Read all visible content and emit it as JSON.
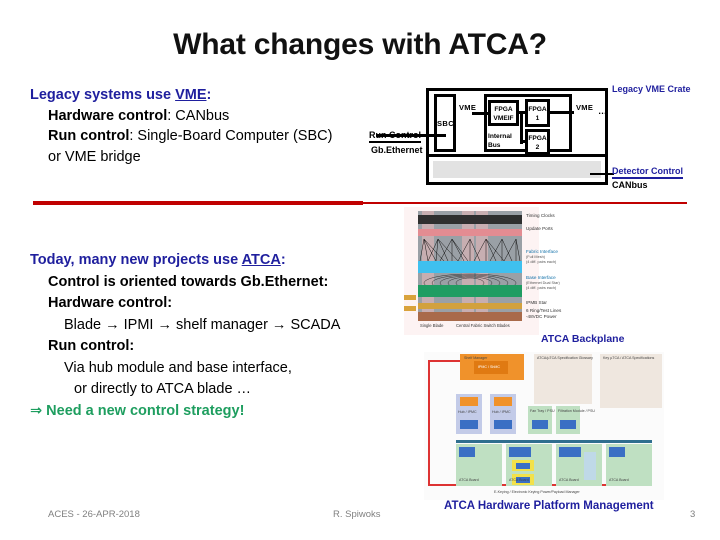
{
  "slide": {
    "title": "What changes with ATCA?",
    "page_number": "3"
  },
  "footer": {
    "left": "ACES - 26-APR-2018",
    "center": "R. Spiwoks",
    "page": "3"
  },
  "legacy_block": {
    "heading_pre": "Legacy systems use ",
    "heading_link": "VME",
    "heading_post": ":",
    "line2_bold": "Hardware control",
    "line2_rest": ": CANbus",
    "line3_bold": "Run control",
    "line3_rest": ": Single-Board Computer (SBC)",
    "line4": "or VME bridge"
  },
  "today_block": {
    "heading_pre": "Today, many new projects use ",
    "heading_link": "ATCA",
    "heading_post": ":",
    "line2": "Control is oriented towards Gb.Ethernet:",
    "line3": "Hardware control:",
    "line4": "Blade → IPMI → shelf manager → SCADA",
    "line5": "Run control:",
    "line6": "Via hub module and base interface,",
    "line7": "or directly to ATCA blade …",
    "line8": "⇒ Need a new control strategy!"
  },
  "vme_crate": {
    "title": "Legacy VME Crate",
    "sbc": "SBC",
    "vme_left": "VME",
    "vme_right": "VME",
    "ellipsis": "…",
    "fpga_vmeif_l1": "FPGA",
    "fpga_vmeif_l2": "VMEIF",
    "fpga1_l1": "FPGA",
    "fpga1_l2": "1",
    "fpga2_l1": "FPGA",
    "fpga2_l2": "2",
    "internal_bus_l1": "Internal",
    "internal_bus_l2": "Bus",
    "run_control": "Run Control",
    "gbethernet": "Gb.Ethernet",
    "detector_control": "Detector Control",
    "canbus": "CANbus"
  },
  "atca_backplane": {
    "caption": "ATCA Backplane",
    "labels": {
      "timing_clocks": "Timing Clocks",
      "update_ports": "Update Ports",
      "fabric_interface": "Fabric Interface",
      "fabric_sub1": "(Full Mesh)",
      "fabric_sub2": "(4 diff. pairs each)",
      "base_interface": "Base Interface",
      "base_sub1": "(Ethernet Dual Star)",
      "base_sub2": "(4 diff. pairs each)",
      "ipmb_star": "IPMB Star",
      "test_lines": "6 Ring/Test Lines",
      "power": "-48VDC Power",
      "single_blade": "Single Blade",
      "central_fabric": "Central Fabric Switch Blades"
    }
  },
  "atca_hpm": {
    "caption": "ATCA Hardware Platform Management",
    "labels": {
      "shelf_manager": "Shelf Manager",
      "shelf_manager_inner": "IPMC / ShMC",
      "legend_title": "ATCA/µTCA Specification Glossary",
      "spec_title": "Key µTCA / ATCA Specifications",
      "hub1": "Hub / IPMC",
      "hub2": "Hub / IPMC",
      "fan1": "Fan Tray / PSU",
      "fan2": "Filtration Module / PSU",
      "blade1": "ATCA Board",
      "blade2": "ATCA Board",
      "blade3": "ATCA Board",
      "blade4": "ATCA Board",
      "ipmc": "IPMC",
      "mmc1": "MMC",
      "mmc2": "MMC",
      "carrier": "Carrier IPMC",
      "footnote": "E-Keying / Electronic Keying Power/Payload Manager"
    }
  },
  "colors": {
    "heading_blue": "#1f1f9e",
    "green": "#1e9e5f",
    "red_divider": "#c00000",
    "footer_gray": "#808080"
  }
}
